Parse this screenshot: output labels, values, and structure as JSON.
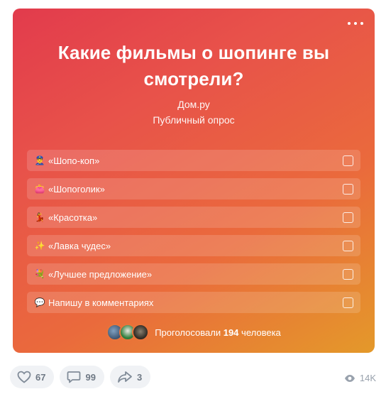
{
  "poll": {
    "title": "Какие фильмы о шопинге вы смотрели?",
    "author": "Дом.ру",
    "type": "Публичный опрос",
    "options": [
      {
        "icon": "👮‍♂",
        "label": "«Шопо-коп»"
      },
      {
        "icon": "👛",
        "label": "«Шопоголик»"
      },
      {
        "icon": "💃",
        "label": "«Красотка»"
      },
      {
        "icon": "✨",
        "label": "«Лавка чудес»"
      },
      {
        "icon": "💐",
        "label": "«Лучшее предложение»"
      },
      {
        "icon": "💬",
        "label": "Напишу в комментариях"
      }
    ],
    "voters_prefix": "Проголосовали",
    "voters_count": "194",
    "voters_suffix": "человека"
  },
  "actions": {
    "likes": "67",
    "comments": "99",
    "shares": "3",
    "views": "14K"
  },
  "colors": {
    "gradient_start": "#e23b4c",
    "gradient_end": "#e4992a",
    "action_bg": "#f0f2f5",
    "action_text": "#6f7985"
  }
}
